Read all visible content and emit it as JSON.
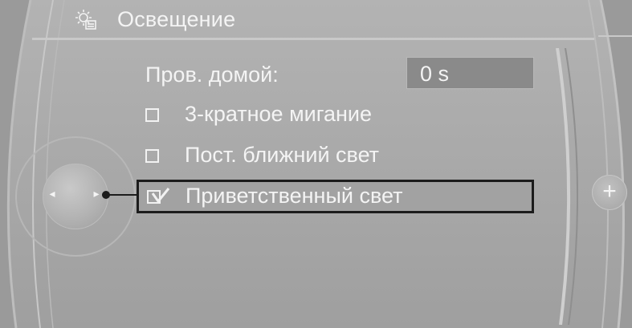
{
  "header": {
    "title": "Освещение",
    "icon": "settings-gear-icon"
  },
  "menu": {
    "home_light": {
      "label": "Пров. домой:",
      "value": "0 s"
    },
    "items": [
      {
        "label": "3-кратное мигание",
        "checked": false
      },
      {
        "label": "Пост. ближний свет",
        "checked": false
      },
      {
        "label": "Приветственный свет",
        "checked": true,
        "selected": true
      }
    ]
  },
  "controller": {
    "left_arrow": "◂",
    "right_arrow": "▸",
    "plus": "+"
  },
  "colors": {
    "background": "#a9a9a9",
    "text": "#f4f4f4",
    "value_field": "#8a8a8a",
    "selection_border": "#1c1c1c"
  }
}
